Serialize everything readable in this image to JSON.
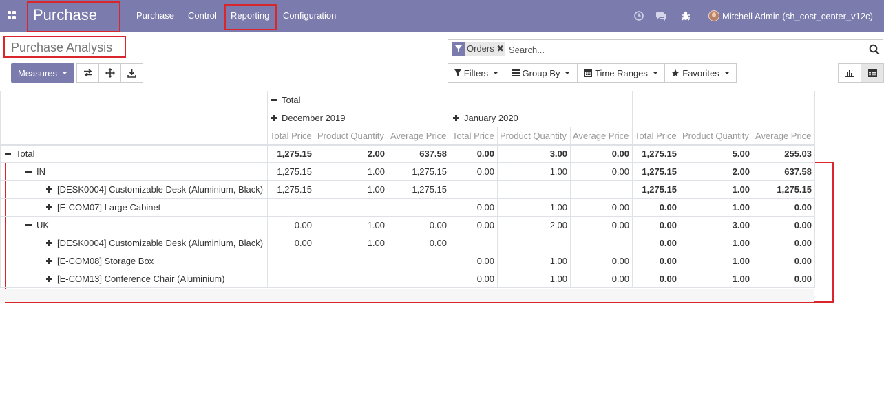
{
  "navbar": {
    "app_name": "Purchase",
    "menu": [
      "Purchase",
      "Control",
      "Reporting",
      "Configuration"
    ],
    "icons": [
      "clock-icon",
      "chat-icon",
      "bug-icon"
    ],
    "user_name": "Mitchell Admin (sh_cost_center_v12c)",
    "bg_color": "#7c7bad"
  },
  "page": {
    "title": "Purchase Analysis"
  },
  "search": {
    "facet_value": "Orders",
    "placeholder": "Search..."
  },
  "toolbar": {
    "measures_label": "Measures",
    "filters_label": "Filters",
    "groupby_label": "Group By",
    "timeranges_label": "Time Ranges",
    "favorites_label": "Favorites",
    "icons": [
      "flip-axis-icon",
      "expand-all-icon",
      "download-icon",
      "bar-chart-icon",
      "pivot-table-icon"
    ]
  },
  "pivot": {
    "col_total_label": "Total",
    "col_groups": [
      "December 2019",
      "January 2020"
    ],
    "measures": [
      "Total Price",
      "Product Quantity",
      "Average Price"
    ],
    "rows": [
      {
        "label": "Total",
        "level": 0,
        "toggle": "minus",
        "cells": [
          "1,275.15",
          "2.00",
          "637.58",
          "0.00",
          "3.00",
          "0.00",
          "1,275.15",
          "5.00",
          "255.03"
        ],
        "bold_all": true
      },
      {
        "label": "IN",
        "level": 1,
        "toggle": "minus",
        "cells": [
          "1,275.15",
          "1.00",
          "1,275.15",
          "0.00",
          "1.00",
          "0.00",
          "1,275.15",
          "2.00",
          "637.58"
        ]
      },
      {
        "label": "[DESK0004] Customizable Desk (Aluminium, Black)",
        "level": 2,
        "toggle": "plus",
        "cells": [
          "1,275.15",
          "1.00",
          "1,275.15",
          "",
          "",
          "",
          "1,275.15",
          "1.00",
          "1,275.15"
        ]
      },
      {
        "label": "[E-COM07] Large Cabinet",
        "level": 2,
        "toggle": "plus",
        "cells": [
          "",
          "",
          "",
          "0.00",
          "1.00",
          "0.00",
          "0.00",
          "1.00",
          "0.00"
        ]
      },
      {
        "label": "UK",
        "level": 1,
        "toggle": "minus",
        "cells": [
          "0.00",
          "1.00",
          "0.00",
          "0.00",
          "2.00",
          "0.00",
          "0.00",
          "3.00",
          "0.00"
        ]
      },
      {
        "label": "[DESK0004] Customizable Desk (Aluminium, Black)",
        "level": 2,
        "toggle": "plus",
        "cells": [
          "0.00",
          "1.00",
          "0.00",
          "",
          "",
          "",
          "0.00",
          "1.00",
          "0.00"
        ]
      },
      {
        "label": "[E-COM08] Storage Box",
        "level": 2,
        "toggle": "plus",
        "cells": [
          "",
          "",
          "",
          "0.00",
          "1.00",
          "0.00",
          "0.00",
          "1.00",
          "0.00"
        ]
      },
      {
        "label": "[E-COM13] Conference Chair (Aluminium)",
        "level": 2,
        "toggle": "plus",
        "cells": [
          "",
          "",
          "",
          "0.00",
          "1.00",
          "0.00",
          "0.00",
          "1.00",
          "0.00"
        ]
      }
    ]
  }
}
